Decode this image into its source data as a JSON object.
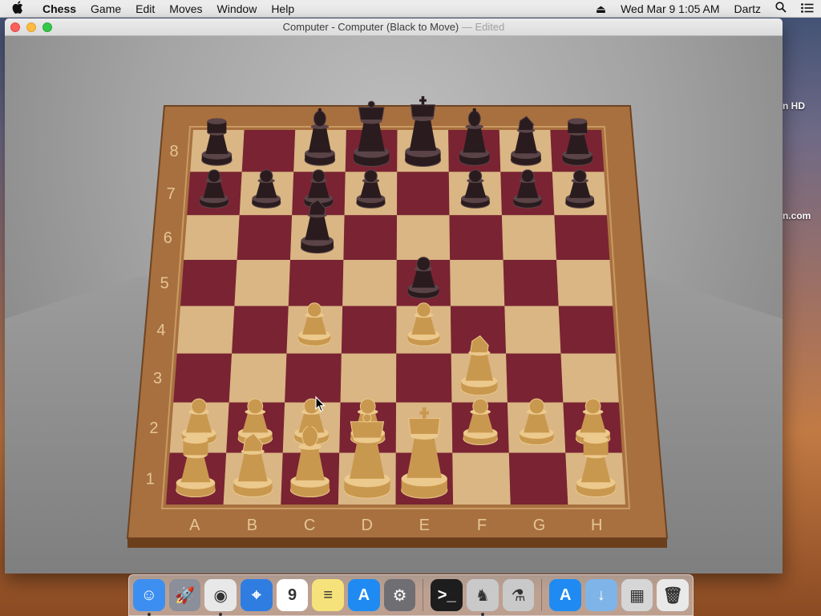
{
  "menubar": {
    "apple_icon": "apple-icon",
    "app_name": "Chess",
    "items": [
      "Game",
      "Edit",
      "Moves",
      "Window",
      "Help"
    ],
    "datetime": "Wed Mar 9  1:05 AM",
    "user": "Dartz"
  },
  "window": {
    "title": "Computer - Computer   (Black to Move)",
    "title_suffix": " — Edited"
  },
  "desktop": {
    "right_edge_text_1": "n HD",
    "right_edge_text_2": "n.com"
  },
  "board": {
    "files": [
      "A",
      "B",
      "C",
      "D",
      "E",
      "F",
      "G",
      "H"
    ],
    "ranks": [
      "8",
      "7",
      "6",
      "5",
      "4",
      "3",
      "2",
      "1"
    ],
    "light_square_color": "#d9b684",
    "dark_square_color": "#7a2333",
    "frame_color": "#a8703f",
    "pieces": [
      {
        "color": "black",
        "type": "rook",
        "square": "a8"
      },
      {
        "color": "black",
        "type": "bishop",
        "square": "c8"
      },
      {
        "color": "black",
        "type": "queen",
        "square": "d8"
      },
      {
        "color": "black",
        "type": "king",
        "square": "e8"
      },
      {
        "color": "black",
        "type": "bishop",
        "square": "f8"
      },
      {
        "color": "black",
        "type": "knight",
        "square": "g8"
      },
      {
        "color": "black",
        "type": "rook",
        "square": "h8"
      },
      {
        "color": "black",
        "type": "pawn",
        "square": "a7"
      },
      {
        "color": "black",
        "type": "pawn",
        "square": "b7"
      },
      {
        "color": "black",
        "type": "pawn",
        "square": "c7"
      },
      {
        "color": "black",
        "type": "pawn",
        "square": "d7"
      },
      {
        "color": "black",
        "type": "pawn",
        "square": "f7"
      },
      {
        "color": "black",
        "type": "pawn",
        "square": "g7"
      },
      {
        "color": "black",
        "type": "pawn",
        "square": "h7"
      },
      {
        "color": "black",
        "type": "knight",
        "square": "c6"
      },
      {
        "color": "black",
        "type": "pawn",
        "square": "e5"
      },
      {
        "color": "white",
        "type": "pawn",
        "square": "c4"
      },
      {
        "color": "white",
        "type": "pawn",
        "square": "e4"
      },
      {
        "color": "white",
        "type": "knight",
        "square": "f3"
      },
      {
        "color": "white",
        "type": "pawn",
        "square": "a2"
      },
      {
        "color": "white",
        "type": "pawn",
        "square": "b2"
      },
      {
        "color": "white",
        "type": "pawn",
        "square": "c2"
      },
      {
        "color": "white",
        "type": "pawn",
        "square": "d2"
      },
      {
        "color": "white",
        "type": "pawn",
        "square": "f2"
      },
      {
        "color": "white",
        "type": "pawn",
        "square": "g2"
      },
      {
        "color": "white",
        "type": "pawn",
        "square": "h2"
      },
      {
        "color": "white",
        "type": "rook",
        "square": "a1"
      },
      {
        "color": "white",
        "type": "knight",
        "square": "b1"
      },
      {
        "color": "white",
        "type": "bishop",
        "square": "c1"
      },
      {
        "color": "white",
        "type": "queen",
        "square": "d1"
      },
      {
        "color": "white",
        "type": "king",
        "square": "e1"
      },
      {
        "color": "white",
        "type": "rook",
        "square": "h1"
      }
    ]
  },
  "dock": {
    "apps": [
      {
        "name": "finder",
        "icon": "finder-icon",
        "color": "#3c8ff0",
        "glyph": "☺",
        "running": true
      },
      {
        "name": "launchpad",
        "icon": "launchpad-icon",
        "color": "#8a8f99",
        "glyph": "🚀",
        "running": false
      },
      {
        "name": "chrome",
        "icon": "chrome-icon",
        "color": "#e8e8e8",
        "glyph": "◉",
        "running": true
      },
      {
        "name": "safari",
        "icon": "safari-icon",
        "color": "#2f7de1",
        "glyph": "⌖",
        "running": false
      },
      {
        "name": "calendar",
        "icon": "calendar-icon",
        "color": "#ffffff",
        "glyph": "9",
        "running": false
      },
      {
        "name": "notes",
        "icon": "notes-icon",
        "color": "#f5e27a",
        "glyph": "≡",
        "running": false
      },
      {
        "name": "app-store",
        "icon": "app-store-icon",
        "color": "#1f8bf2",
        "glyph": "A",
        "running": false
      },
      {
        "name": "system-prefs",
        "icon": "system-prefs-icon",
        "color": "#6e6e73",
        "glyph": "⚙",
        "running": false
      }
    ],
    "apps2": [
      {
        "name": "terminal",
        "icon": "terminal-icon",
        "color": "#1d1d1d",
        "glyph": ">_",
        "running": false
      },
      {
        "name": "chess",
        "icon": "chess-knight-icon",
        "color": "#c9c9c9",
        "glyph": "♞",
        "running": true
      },
      {
        "name": "system-info",
        "icon": "system-info-icon",
        "color": "#c9c9c9",
        "glyph": "⚗",
        "running": false
      }
    ],
    "stack": [
      {
        "name": "app-store-folder",
        "icon": "app-store-icon",
        "color": "#1f8bf2",
        "glyph": "A"
      },
      {
        "name": "downloads",
        "icon": "downloads-folder-icon",
        "color": "#7fb4e8",
        "glyph": "↓"
      },
      {
        "name": "screenshots",
        "icon": "screenshots-icon",
        "color": "#d6d6d6",
        "glyph": "▦"
      },
      {
        "name": "trash",
        "icon": "trash-icon",
        "color": "#e9e9e9",
        "glyph": "🗑"
      }
    ]
  }
}
